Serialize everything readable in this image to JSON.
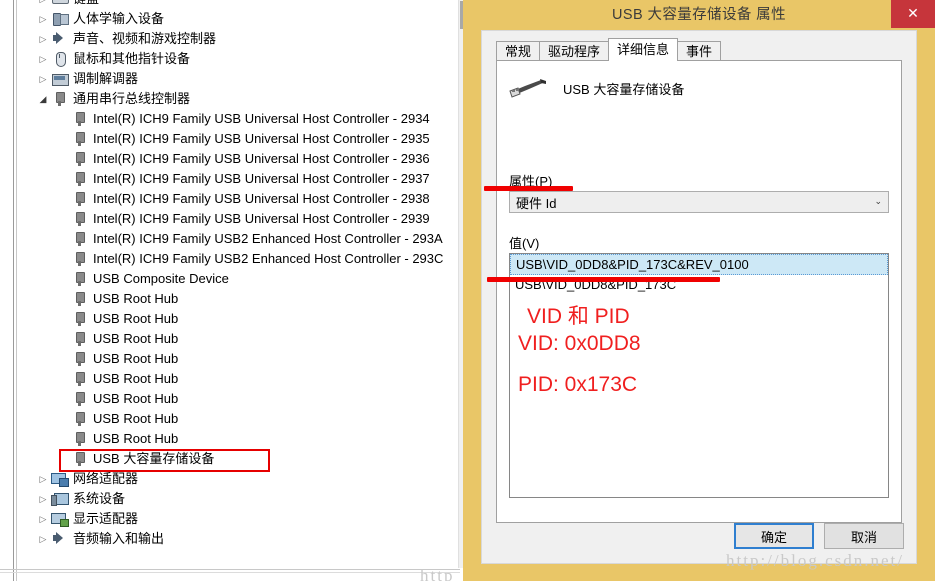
{
  "device_manager": {
    "scrollbar": {
      "present": true
    },
    "tree": [
      {
        "indent": 0,
        "twisty": "collapsed",
        "icon": "keyboard-icon",
        "label": "键盘"
      },
      {
        "indent": 0,
        "twisty": "collapsed",
        "icon": "hid-icon",
        "label": "人体学输入设备"
      },
      {
        "indent": 0,
        "twisty": "collapsed",
        "icon": "sound-icon",
        "label": "声音、视频和游戏控制器"
      },
      {
        "indent": 0,
        "twisty": "collapsed",
        "icon": "mouse-icon",
        "label": "鼠标和其他指针设备"
      },
      {
        "indent": 0,
        "twisty": "collapsed",
        "icon": "modem-icon",
        "label": "调制解调器"
      },
      {
        "indent": 0,
        "twisty": "expanded",
        "icon": "usb-icon",
        "label": "通用串行总线控制器"
      },
      {
        "indent": 1,
        "twisty": "none",
        "icon": "usb-icon",
        "label": "Intel(R) ICH9 Family USB Universal Host Controller - 2934"
      },
      {
        "indent": 1,
        "twisty": "none",
        "icon": "usb-icon",
        "label": "Intel(R) ICH9 Family USB Universal Host Controller - 2935"
      },
      {
        "indent": 1,
        "twisty": "none",
        "icon": "usb-icon",
        "label": "Intel(R) ICH9 Family USB Universal Host Controller - 2936"
      },
      {
        "indent": 1,
        "twisty": "none",
        "icon": "usb-icon",
        "label": "Intel(R) ICH9 Family USB Universal Host Controller - 2937"
      },
      {
        "indent": 1,
        "twisty": "none",
        "icon": "usb-icon",
        "label": "Intel(R) ICH9 Family USB Universal Host Controller - 2938"
      },
      {
        "indent": 1,
        "twisty": "none",
        "icon": "usb-icon",
        "label": "Intel(R) ICH9 Family USB Universal Host Controller - 2939"
      },
      {
        "indent": 1,
        "twisty": "none",
        "icon": "usb-icon",
        "label": "Intel(R) ICH9 Family USB2 Enhanced Host Controller - 293A"
      },
      {
        "indent": 1,
        "twisty": "none",
        "icon": "usb-icon",
        "label": "Intel(R) ICH9 Family USB2 Enhanced Host Controller - 293C"
      },
      {
        "indent": 1,
        "twisty": "none",
        "icon": "usb-icon",
        "label": "USB Composite Device"
      },
      {
        "indent": 1,
        "twisty": "none",
        "icon": "usb-icon",
        "label": "USB Root Hub"
      },
      {
        "indent": 1,
        "twisty": "none",
        "icon": "usb-icon",
        "label": "USB Root Hub"
      },
      {
        "indent": 1,
        "twisty": "none",
        "icon": "usb-icon",
        "label": "USB Root Hub"
      },
      {
        "indent": 1,
        "twisty": "none",
        "icon": "usb-icon",
        "label": "USB Root Hub"
      },
      {
        "indent": 1,
        "twisty": "none",
        "icon": "usb-icon",
        "label": "USB Root Hub"
      },
      {
        "indent": 1,
        "twisty": "none",
        "icon": "usb-icon",
        "label": "USB Root Hub"
      },
      {
        "indent": 1,
        "twisty": "none",
        "icon": "usb-icon",
        "label": "USB Root Hub"
      },
      {
        "indent": 1,
        "twisty": "none",
        "icon": "usb-icon",
        "label": "USB Root Hub"
      },
      {
        "indent": 1,
        "twisty": "none",
        "icon": "usb-icon",
        "label": "USB 大容量存储设备",
        "highlighted": true
      },
      {
        "indent": 0,
        "twisty": "collapsed",
        "icon": "network-icon",
        "label": "网络适配器"
      },
      {
        "indent": 0,
        "twisty": "collapsed",
        "icon": "system-icon",
        "label": "系统设备"
      },
      {
        "indent": 0,
        "twisty": "collapsed",
        "icon": "display-icon",
        "label": "显示适配器"
      },
      {
        "indent": 0,
        "twisty": "collapsed",
        "icon": "sound-icon",
        "label": "音频输入和输出"
      }
    ]
  },
  "dialog": {
    "title": "USB 大容量存储设备 属性",
    "close_label": "✕",
    "tabs": [
      {
        "label": "常规",
        "active": false
      },
      {
        "label": "驱动程序",
        "active": false
      },
      {
        "label": "详细信息",
        "active": true
      },
      {
        "label": "事件",
        "active": false
      }
    ],
    "device_name": "USB 大容量存储设备",
    "device_icon": "usb-plug-icon",
    "property_label": "属性(P)",
    "property_selected": "硬件 Id",
    "property_options": [
      "硬件 Id"
    ],
    "dropdown_arrow": "⌄",
    "value_label": "值(V)",
    "values": [
      {
        "text": "USB\\VID_0DD8&PID_173C&REV_0100",
        "selected": true
      },
      {
        "text": "USB\\VID_0DD8&PID_173C",
        "selected": false
      }
    ],
    "buttons": {
      "ok": "确定",
      "cancel": "取消"
    },
    "colors": {
      "titlebar": "#e9c667",
      "close_button": "#c6353b",
      "ok_focus_border": "#2f7fd0",
      "selection": "#cde8f6"
    }
  },
  "annotations": {
    "color": "#f01f1f",
    "notes": [
      "VID 和 PID",
      "VID: 0x0DD8",
      "PID: 0x173C"
    ],
    "underlines": 2,
    "highlight_box_target": "USB 大容量存储设备"
  },
  "watermark": {
    "text": "http://blog.csdn.net/",
    "partial": "http"
  }
}
